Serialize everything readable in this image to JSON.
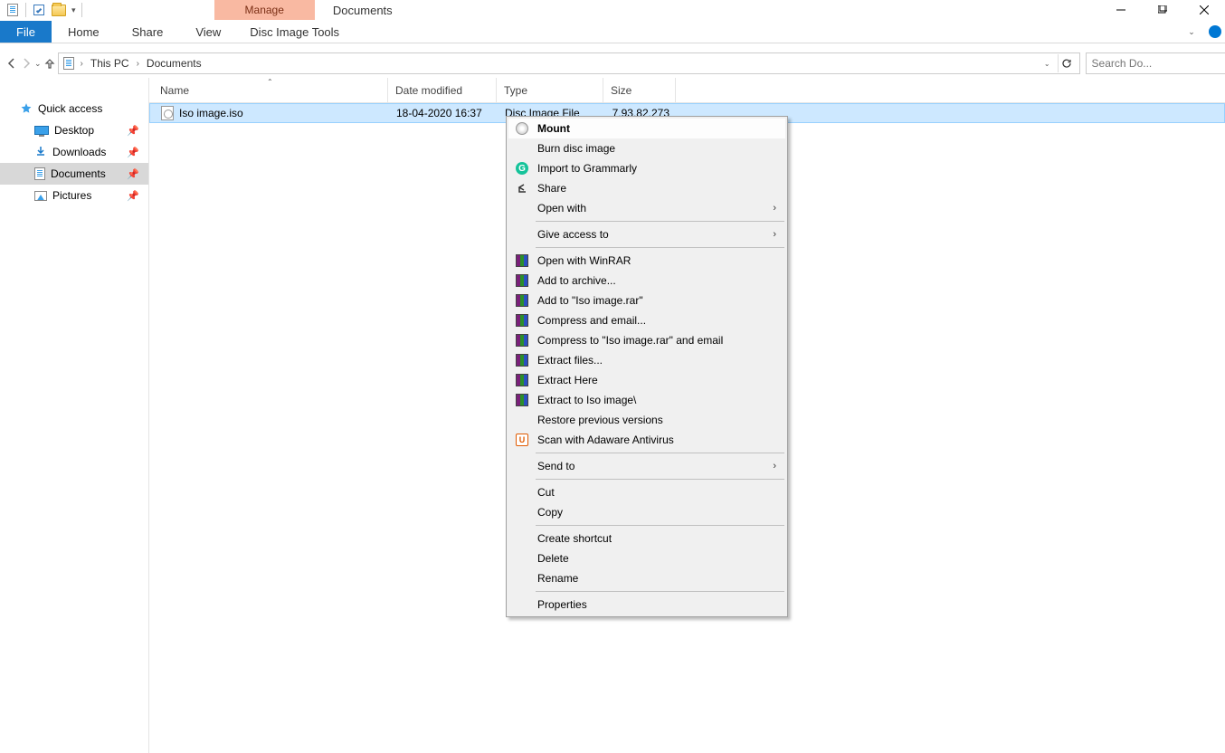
{
  "titlebar": {
    "context_tab": "Manage",
    "window_title": "Documents"
  },
  "ribbon": {
    "file": "File",
    "tabs": [
      "Home",
      "Share",
      "View"
    ],
    "context_tab": "Disc Image Tools"
  },
  "breadcrumbs": {
    "items": [
      "This PC",
      "Documents"
    ]
  },
  "search": {
    "placeholder": "Search Do..."
  },
  "sidebar": {
    "quick_access": "Quick access",
    "items": [
      {
        "label": "Desktop"
      },
      {
        "label": "Downloads"
      },
      {
        "label": "Documents"
      },
      {
        "label": "Pictures"
      }
    ]
  },
  "columns": {
    "name": "Name",
    "date": "Date modified",
    "type": "Type",
    "size": "Size"
  },
  "files": [
    {
      "name": "Iso image.iso",
      "date": "18-04-2020 16:37",
      "type": "Disc Image File",
      "size": "7,93,82,273"
    }
  ],
  "context_menu": {
    "mount": "Mount",
    "burn": "Burn disc image",
    "grammarly": "Import to Grammarly",
    "share": "Share",
    "open_with": "Open with",
    "give_access": "Give access to",
    "winrar_open": "Open with WinRAR",
    "add_archive": "Add to archive...",
    "add_rar": "Add to \"Iso image.rar\"",
    "compress_email": "Compress and email...",
    "compress_rar_email": "Compress to \"Iso image.rar\" and email",
    "extract_files": "Extract files...",
    "extract_here": "Extract Here",
    "extract_to": "Extract to Iso image\\",
    "restore": "Restore previous versions",
    "adaware": "Scan with Adaware Antivirus",
    "send_to": "Send to",
    "cut": "Cut",
    "copy": "Copy",
    "create_shortcut": "Create shortcut",
    "delete": "Delete",
    "rename": "Rename",
    "properties": "Properties"
  }
}
